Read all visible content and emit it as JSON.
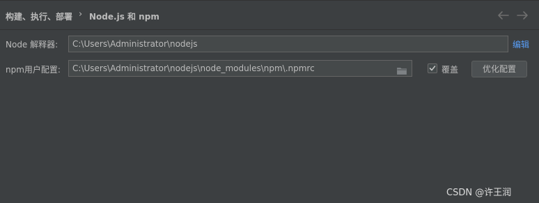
{
  "breadcrumb": {
    "parent": "构建、执行、部署",
    "separator": "›",
    "current": "Node.js 和 npm"
  },
  "nav": {
    "back_icon": "arrow-left-icon",
    "forward_icon": "arrow-right-icon"
  },
  "interpreter": {
    "label": "Node 解释器:",
    "value": "C:\\Users\\Administrator\\nodejs",
    "edit_link": "编辑"
  },
  "npm_config": {
    "label": "npm用户配置:",
    "value": "C:\\Users\\Administrator\\nodejs\\node_modules\\npm\\.npmrc",
    "browse_icon": "folder-icon",
    "override_label": "覆盖",
    "override_checked": true,
    "optimize_button": "优化配置"
  },
  "watermark": "CSDN @许王润",
  "colors": {
    "background": "#3c3f41",
    "field_bg": "#45494a",
    "link": "#589df6",
    "text": "#bbbbbb"
  }
}
